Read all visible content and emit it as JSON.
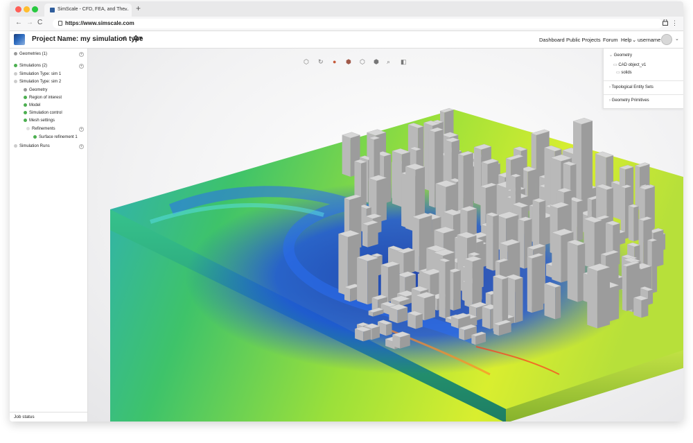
{
  "browser": {
    "tab_title": "SimScale - CFD, FEA, and The...",
    "tab_close": "×",
    "new_tab": "+",
    "back": "←",
    "forward": "→",
    "reload": "C",
    "url": "https://www.simscale.com",
    "menu_icon": "⋮"
  },
  "header": {
    "project_name": "Project Name: my simulation type",
    "share_icon": "<",
    "settings_icon": "✿▾",
    "nav": {
      "dashboard": "Dashboard",
      "public_projects": "Public Projects",
      "forum": "Forum",
      "help": "Help",
      "username": "username"
    },
    "dropdown_chevron": "⌄"
  },
  "tree": {
    "geometries": "Geometries (1)",
    "simulations": "Simulations (2)",
    "sim1": "Simulation Type: sim 1",
    "sim2": "Simulation Type: sim 2",
    "geometry": "Geometry",
    "region": "Region of interest",
    "model": "Model",
    "sim_control": "Simulation control",
    "mesh": "Mesh settings",
    "refinements": "Refinements",
    "surface_ref": "Surface refinement 1",
    "runs": "Simulation Runs",
    "add": "+"
  },
  "job_status": "Job status",
  "right_panel": {
    "geometry": "Geometry",
    "cad": "CAD object_v1",
    "solids": "solids",
    "topo": "Topological Entity Sets",
    "prim": "Geometry Primitives"
  },
  "colors": {
    "accent": "#2d6cc0",
    "status_ok": "#4caf50",
    "flow_fast": "#ff3b1f",
    "flow_mid": "#e6f02a",
    "flow_low": "#22c05a",
    "flow_slow": "#1535c8"
  }
}
